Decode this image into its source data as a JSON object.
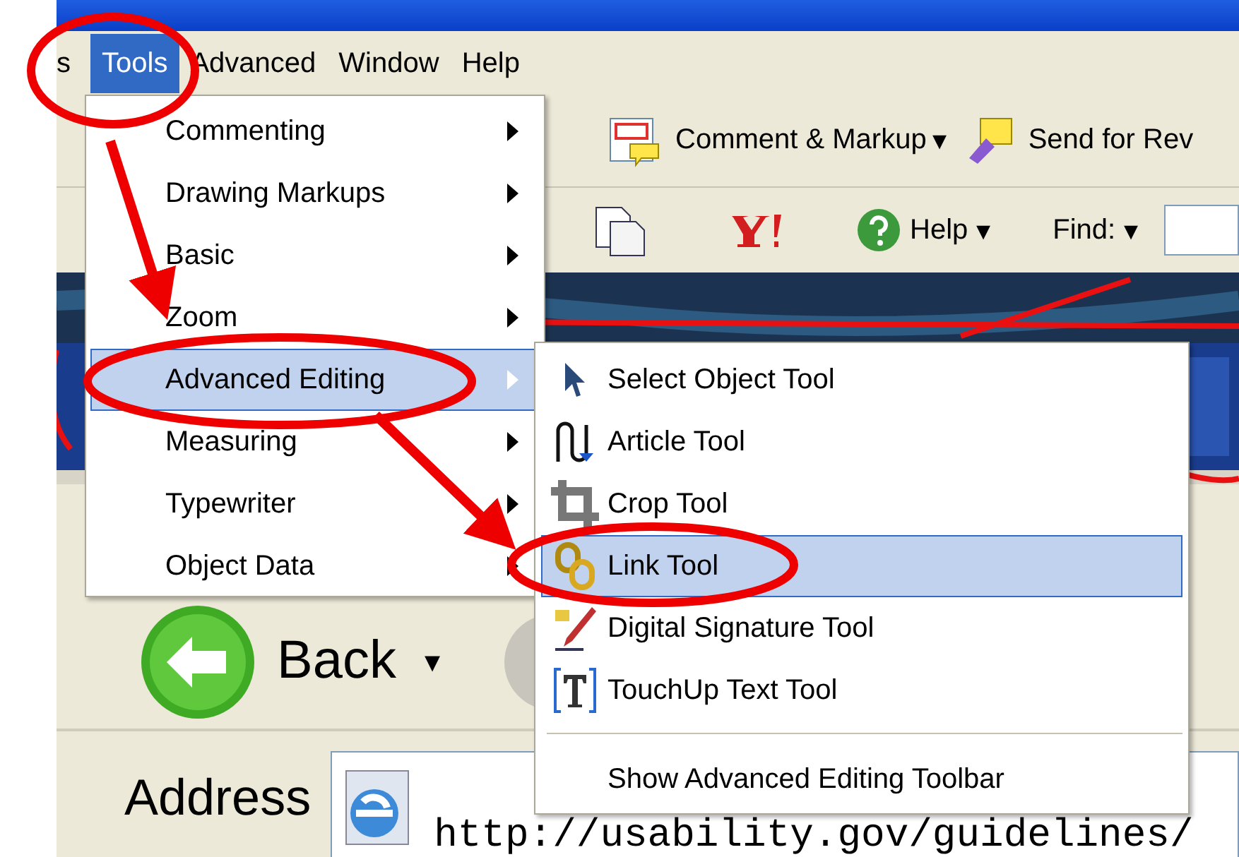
{
  "menu_bar": [
    {
      "label": "s",
      "selected": false
    },
    {
      "label": "Tools",
      "selected": true
    },
    {
      "label": "Advanced",
      "selected": false
    },
    {
      "label": "Window",
      "selected": false
    },
    {
      "label": "Help",
      "selected": false
    }
  ],
  "toolbar_top": {
    "comment": "Comment & Markup",
    "comment_caret": "▾",
    "send": "Send for Rev"
  },
  "toolbar_second": {
    "help": "Help",
    "help_caret": "▾",
    "find": "Find:",
    "find_caret": "▾"
  },
  "browser": {
    "back": "Back",
    "back_caret": "▾",
    "address_label": "Address",
    "address": "http://usability.gov/guidelines/"
  },
  "tools_menu": [
    {
      "label": "Commenting",
      "selected": false
    },
    {
      "label": "Drawing Markups",
      "selected": false
    },
    {
      "label": "Basic",
      "selected": false
    },
    {
      "label": "Zoom",
      "selected": false
    },
    {
      "label": "Advanced Editing",
      "selected": true
    },
    {
      "label": "Measuring",
      "selected": false
    },
    {
      "label": "Typewriter",
      "selected": false
    },
    {
      "label": "Object Data",
      "selected": false
    }
  ],
  "advanced_editing_submenu": [
    {
      "label": "Select Object Tool",
      "kind": "tool",
      "selected": false
    },
    {
      "label": "Article Tool",
      "kind": "tool",
      "selected": false
    },
    {
      "label": "Crop Tool",
      "kind": "tool",
      "selected": false
    },
    {
      "label": "Link Tool",
      "kind": "tool",
      "selected": true
    },
    {
      "label": "Digital Signature Tool",
      "kind": "tool",
      "selected": false
    },
    {
      "label": "TouchUp Text Tool",
      "kind": "tool",
      "selected": false
    },
    {
      "label": "Show Advanced Editing Toolbar",
      "kind": "command",
      "selected": false
    }
  ]
}
